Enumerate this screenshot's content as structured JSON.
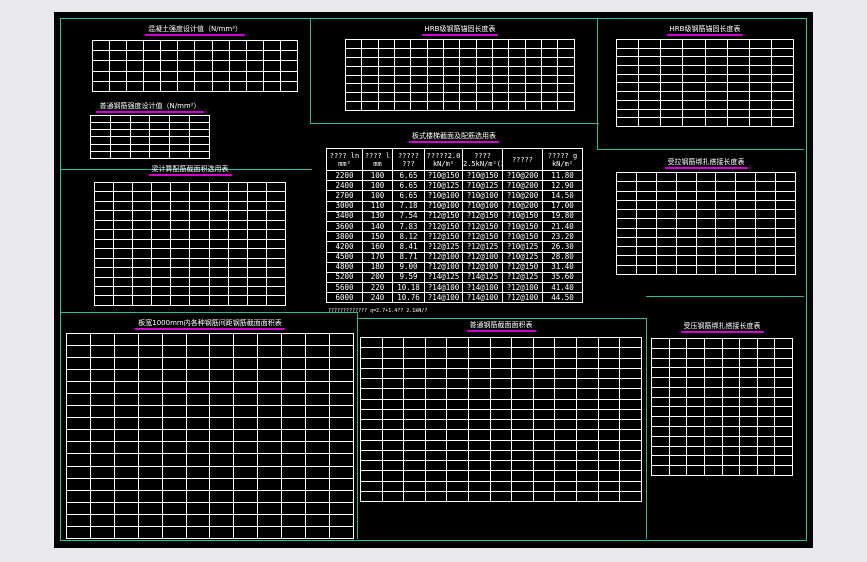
{
  "drawing": {
    "background": "#000000",
    "frame_color": "#18c8b4",
    "title_underline_color": "#d000d0"
  },
  "panels": {
    "p1": {
      "title": "混凝土强度设计值（N/mm²）"
    },
    "p2": {
      "title": "HRB级钢筋锚固长度表"
    },
    "p3": {
      "title": "HRB级钢筋锚固长度表"
    },
    "p4": {
      "title": "普通钢筋强度设计值（N/mm²）"
    },
    "p5": {
      "title": "板式楼梯截面及配筋选用表"
    },
    "p6": {
      "title": "梁计算配筋截面积选用表"
    },
    "p7": {
      "title": "受拉钢筋绑扎搭接长度表"
    },
    "p8": {
      "title": "板宽1000mm内各种钢筋间距钢筋截面面积表"
    },
    "p9": {
      "title": "普通钢筋截面面积表"
    },
    "p10": {
      "title": "受压钢筋绑扎搭接长度表"
    }
  },
  "stair_table": {
    "headers": [
      "???? ln mm²",
      "???? l mm",
      "????? ???",
      "?????2.0 kN/m²",
      "????2.5kN/m²(2.5kN/m²)",
      "?????",
      "????? g kN/m²"
    ],
    "rows": [
      [
        "2200",
        "100",
        "6.65",
        "?10@150",
        "?10@150",
        "?10@200",
        "11.80"
      ],
      [
        "2400",
        "100",
        "6.65",
        "?10@125",
        "?10@125",
        "?10@200",
        "12.90"
      ],
      [
        "2700",
        "100",
        "6.65",
        "?10@100",
        "?10@100",
        "?10@200",
        "14.50"
      ],
      [
        "3000",
        "110",
        "7.18",
        "?10@100",
        "?10@100",
        "?10@200",
        "17.00"
      ],
      [
        "3400",
        "130",
        "7.54",
        "?12@150",
        "?12@150",
        "?10@150",
        "19.80"
      ],
      [
        "3600",
        "140",
        "7.83",
        "?12@150",
        "?12@150",
        "?10@150",
        "21.40"
      ],
      [
        "3800",
        "150",
        "8.12",
        "?12@150",
        "?12@150",
        "?10@150",
        "23.20"
      ],
      [
        "4200",
        "160",
        "8.41",
        "?12@125",
        "?12@125",
        "?10@125",
        "26.30"
      ],
      [
        "4500",
        "170",
        "8.71",
        "?12@100",
        "?12@100",
        "?10@125",
        "28.80"
      ],
      [
        "4800",
        "180",
        "9.00",
        "?12@100",
        "?12@100",
        "?12@150",
        "31.40"
      ],
      [
        "5200",
        "200",
        "9.59",
        "?14@125",
        "?14@125",
        "?12@125",
        "35.60"
      ],
      [
        "5600",
        "220",
        "10.18",
        "?14@100",
        "?14@100",
        "?12@100",
        "41.40"
      ],
      [
        "6000",
        "240",
        "10.76",
        "?14@100",
        "?14@100",
        "?12@100",
        "44.50"
      ]
    ],
    "note": "????????????? q=2.7+1.4?? 2.1kN/?"
  }
}
